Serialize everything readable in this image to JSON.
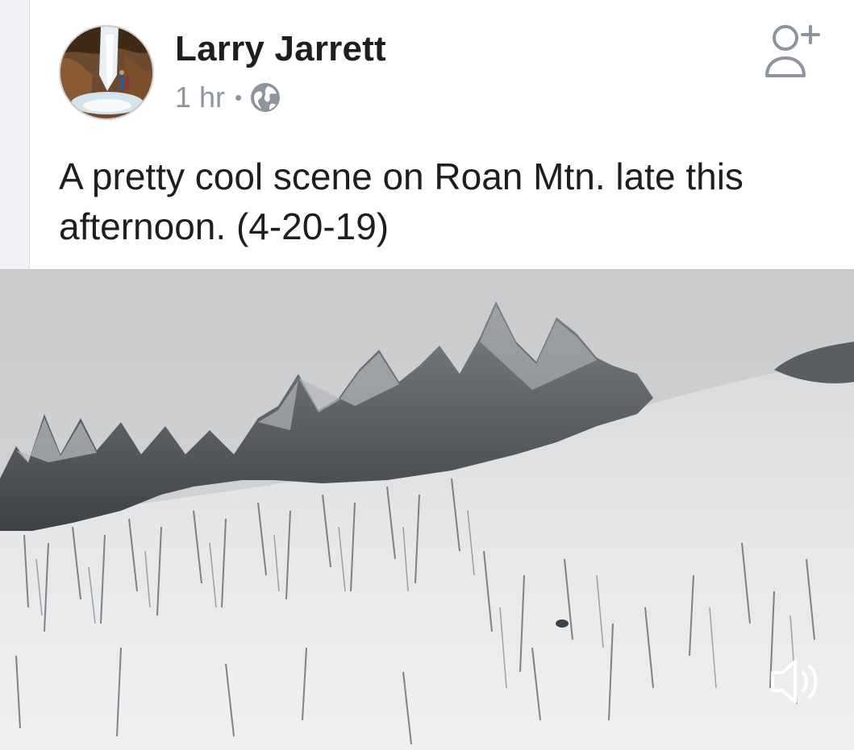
{
  "post": {
    "author": "Larry Jarrett",
    "time": "1 hr",
    "separator": "•",
    "privacy_icon": "globe-icon",
    "add_friend_icon": "add-friend-icon",
    "text": "A pretty cool scene on Roan Mtn. late this afternoon. (4-20-19)"
  },
  "video": {
    "sound_icon": "speaker-icon",
    "muted": false
  },
  "colors": {
    "author": "#1c1e21",
    "meta": "#8d949e",
    "background": "#ffffff"
  }
}
